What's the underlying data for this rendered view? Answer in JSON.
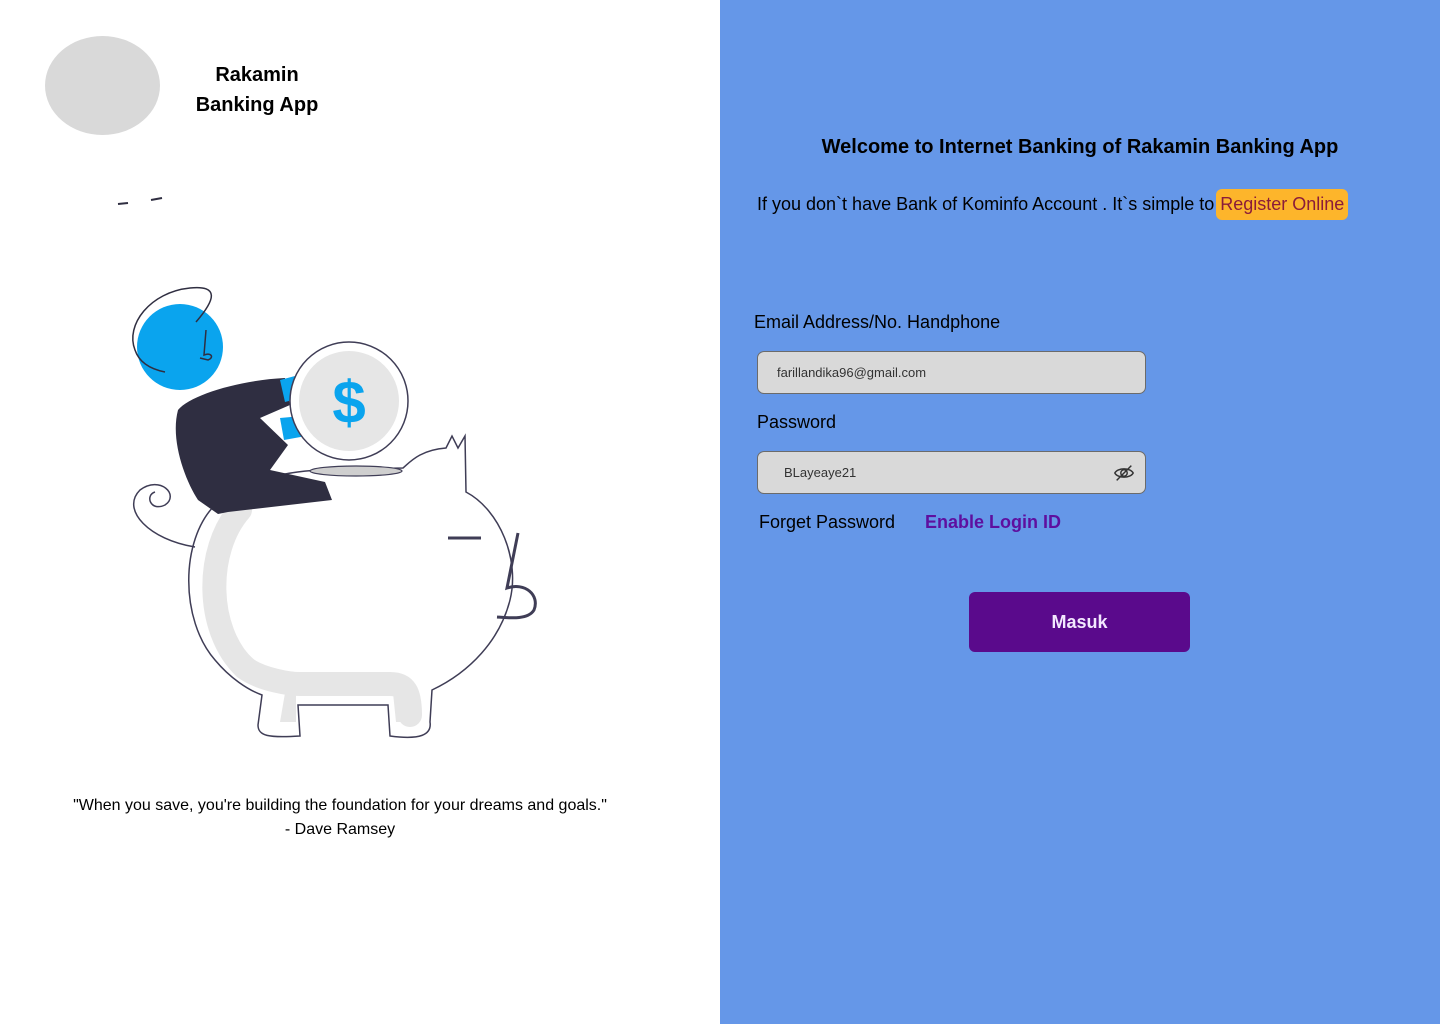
{
  "brand": {
    "app_name_line1": "Rakamin",
    "app_name_line2": "Banking App"
  },
  "quote": {
    "text": "\"When you save, you're building the foundation for your dreams and goals.\" - Dave Ramsey"
  },
  "login": {
    "welcome": "Welcome to Internet Banking of Rakamin Banking App",
    "register_prompt": "If you don`t have Bank of Kominfo Account . It`s simple to",
    "register_link": "Register Online",
    "email_label": "Email Address/No. Handphone",
    "email_value": "farillandika96@gmail.com",
    "password_label": "Password",
    "password_value": "BLayeaye21",
    "forget_password": "Forget Password",
    "enable_login_id": "Enable Login ID",
    "submit_label": "Masuk"
  },
  "icons": {
    "password_toggle": "eye-slash-icon",
    "coin": "dollar-coin-icon"
  },
  "colors": {
    "right_panel_bg": "#6597e8",
    "register_highlight": "#fdb52b",
    "submit_bg": "#5a0a8c",
    "enable_link": "#5e0f9f",
    "field_bg": "#d9d9d9",
    "accent_blue": "#0aa4ee"
  }
}
